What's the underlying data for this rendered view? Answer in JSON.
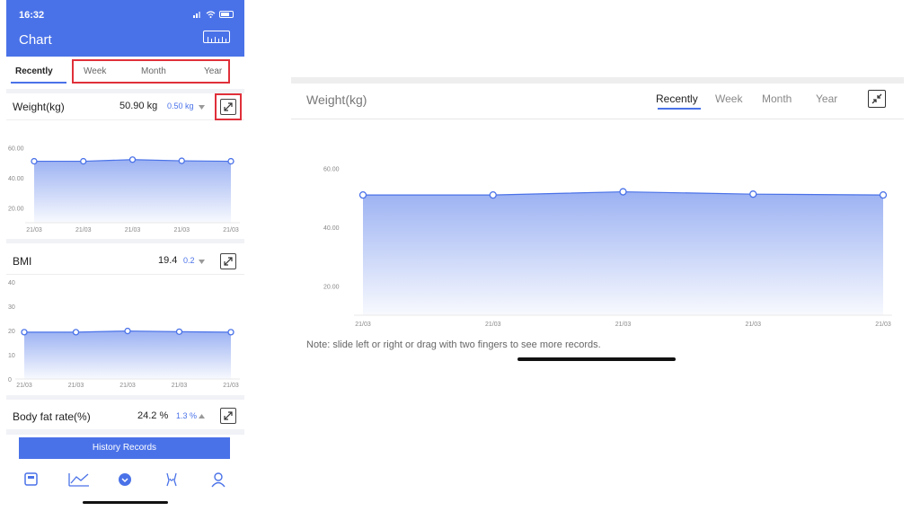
{
  "phone": {
    "status_time": "16:32",
    "title": "Chart",
    "tabs": [
      "Recently",
      "Week",
      "Month",
      "Year"
    ],
    "active_tab": "Recently",
    "metrics": [
      {
        "name": "Weight(kg)",
        "value": "50.90 kg",
        "delta": "0.50 kg",
        "trend": "down",
        "chart_data": {
          "type": "area",
          "x": [
            "21/03",
            "21/03",
            "21/03",
            "21/03",
            "21/03"
          ],
          "y": [
            50.9,
            50.9,
            52.0,
            51.2,
            50.9
          ],
          "yticks": [
            "60.00",
            "40.00",
            "20.00"
          ],
          "ylim": [
            10,
            65
          ]
        }
      },
      {
        "name": "BMI",
        "value": "19.4",
        "delta": "0.2",
        "trend": "down",
        "chart_data": {
          "type": "area",
          "x": [
            "21/03",
            "21/03",
            "21/03",
            "21/03",
            "21/03"
          ],
          "y": [
            19.3,
            19.3,
            19.8,
            19.5,
            19.3
          ],
          "yticks": [
            "40",
            "30",
            "20",
            "10",
            "0"
          ],
          "ylim": [
            0,
            40
          ]
        }
      },
      {
        "name": "Body fat rate(%)",
        "value": "24.2 %",
        "delta": "1.3 %",
        "trend": "up"
      }
    ],
    "history_button": "History Records",
    "nav_icons": [
      "scale-icon",
      "chart-icon",
      "home-icon",
      "body-icon",
      "profile-icon"
    ]
  },
  "landscape": {
    "title": "Weight(kg)",
    "tabs": [
      "Recently",
      "Week",
      "Month",
      "Year"
    ],
    "active_tab": "Recently",
    "note": "Note: slide left or right or drag with two fingers to see more records.",
    "chart_data": {
      "type": "area",
      "x": [
        "21/03",
        "21/03",
        "21/03",
        "21/03",
        "21/03"
      ],
      "y": [
        50.9,
        50.9,
        52.0,
        51.2,
        50.9
      ],
      "yticks": [
        "60.00",
        "40.00",
        "20.00"
      ],
      "ylim": [
        10,
        65
      ]
    }
  },
  "colors": {
    "accent": "#4a72e8",
    "highlight": "#e0303a"
  }
}
